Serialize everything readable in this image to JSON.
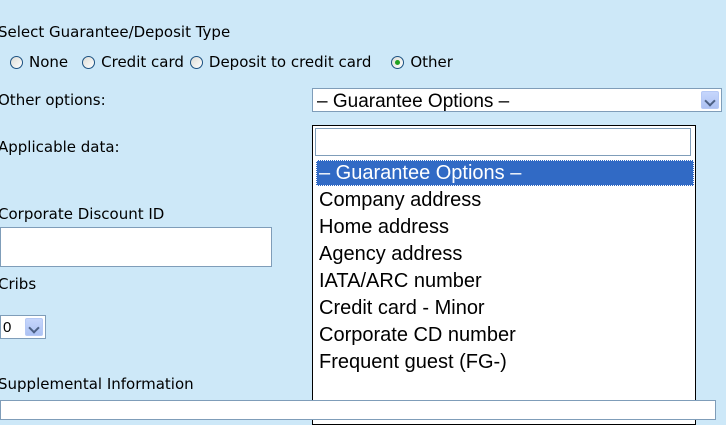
{
  "section_title": "Select Guarantee/Deposit Type",
  "guarantee_types": [
    {
      "label": "None",
      "checked": false
    },
    {
      "label": "Credit card",
      "checked": false
    },
    {
      "label": "Deposit to credit card",
      "checked": false
    },
    {
      "label": "Other",
      "checked": true
    }
  ],
  "other_options": {
    "label": "Other options:",
    "selected": "– Guarantee Options –",
    "list_items": [
      "– Guarantee Options –",
      "Company address",
      "Home address",
      "Agency address",
      "IATA/ARC number",
      "Credit card - Minor",
      "Corporate CD number",
      "Frequent guest (FG-)"
    ],
    "highlighted_index": 0
  },
  "applicable_data_label": "Applicable data:",
  "corporate_discount": {
    "label": "Corporate Discount ID",
    "value": ""
  },
  "cribs": {
    "label": "Cribs",
    "value": "0"
  },
  "supplemental_label": "Supplemental Information"
}
